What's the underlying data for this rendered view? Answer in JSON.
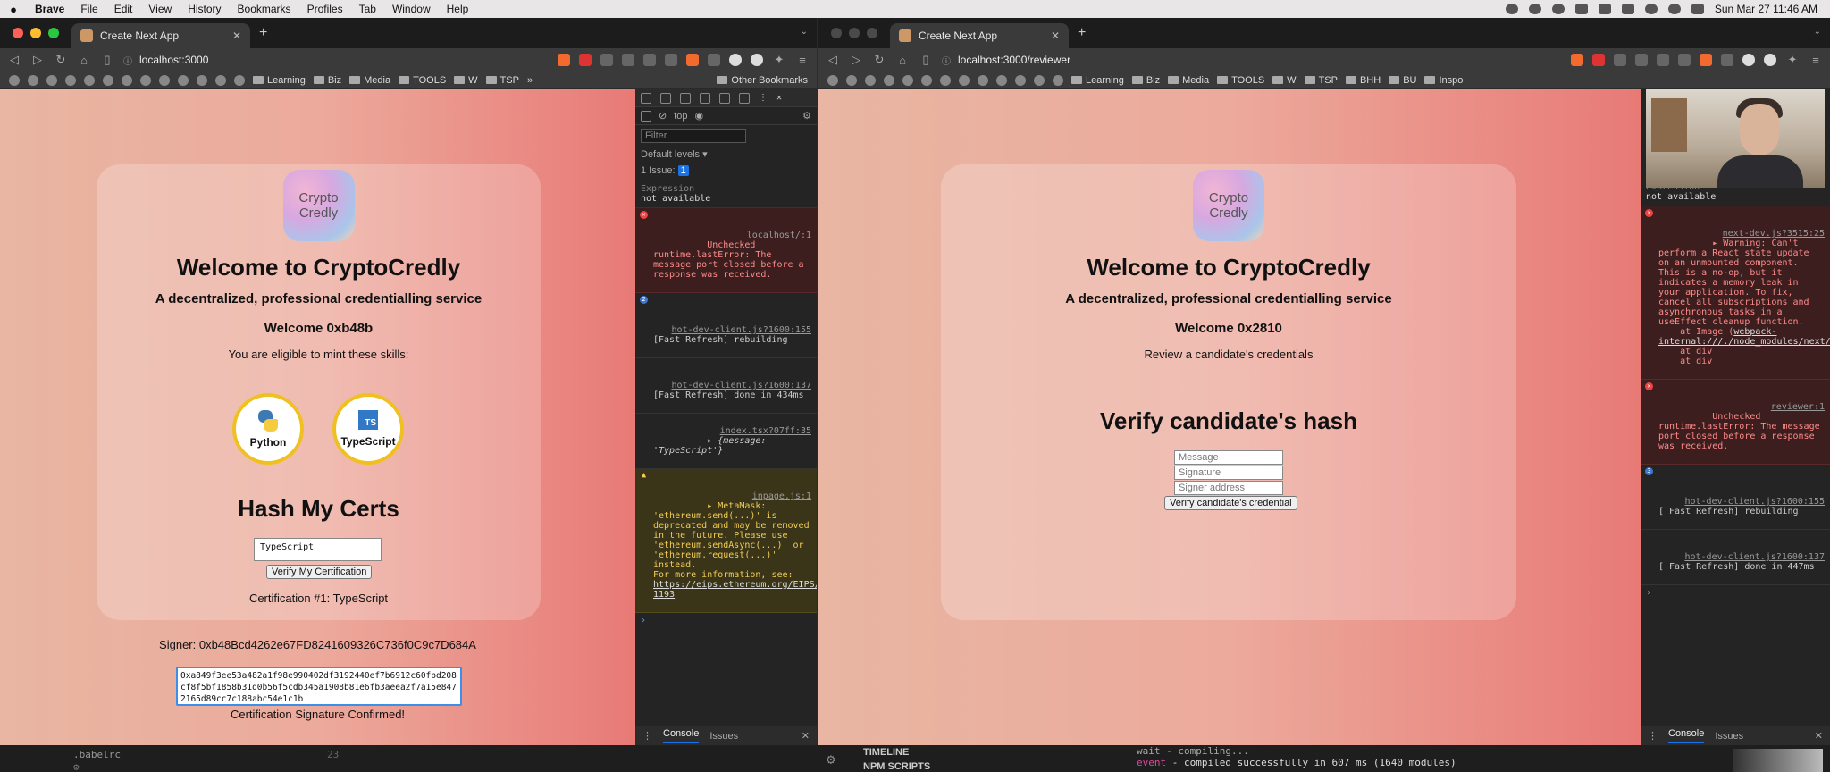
{
  "menubar": {
    "app": "Brave",
    "items": [
      "File",
      "Edit",
      "View",
      "History",
      "Bookmarks",
      "Profiles",
      "Tab",
      "Window",
      "Help"
    ],
    "clock": "Sun Mar 27  11:46 AM"
  },
  "left": {
    "tab_title": "Create Next App",
    "url": "localhost:3000",
    "bookmarks": [
      "Learning",
      "Biz",
      "Media",
      "TOOLS",
      "W",
      "TSP"
    ],
    "other_bookmarks": "Other Bookmarks",
    "page": {
      "logo_line1": "Crypto",
      "logo_line2": "Credly",
      "title": "Welcome to CryptoCredly",
      "subtitle": "A decentralized, professional credentialling service",
      "welcome": "Welcome 0xb48b",
      "eligible": "You are eligible to mint these skills:",
      "skills": [
        {
          "name": "Python",
          "icon": "python-icon"
        },
        {
          "name": "TypeScript",
          "icon": "typescript-icon",
          "badge": "TS"
        }
      ],
      "hash_heading": "Hash My Certs",
      "hash_input_value": "TypeScript",
      "verify_button": "Verify My Certification",
      "cert_line": "Certification #1: TypeScript",
      "signer_line": "Signer: 0xb48Bcd4262e67FD8241609326C736f0C9c7D684A",
      "signature": "0xa849f3ee53a482a1f98e990402df3192440ef7b6912c60fbd208cf8f5bf1858b31d0b56f5cdb345a1908b81e6fb3aeea2f7a15e8472165d89cc7c188abc54e1c1b",
      "confirmed": "Certification Signature Confirmed!"
    },
    "devtools": {
      "context": "top",
      "filter_placeholder": "Filter",
      "levels": "Default levels ▾",
      "issues_label": "1 Issue:",
      "issues_count": "1",
      "expression_label": "Expression",
      "expression_value": "not available",
      "logs": [
        {
          "kind": "err",
          "text": "Unchecked runtime.lastError: The message port closed before a response was received.",
          "src": "localhost/:1"
        },
        {
          "kind": "info",
          "count": "2",
          "text": "[Fast Refresh] rebuilding",
          "src": "hot-dev-client.js?1600:155"
        },
        {
          "kind": "info",
          "text": "[Fast Refresh] done in 434ms",
          "src": "hot-dev-client.js?1600:137"
        },
        {
          "kind": "obj",
          "text": "▸ {message: 'TypeScript'}",
          "src": "index.tsx?07ff:35"
        },
        {
          "kind": "warn",
          "text": "▸ MetaMask: 'ethereum.send(...)' is deprecated and may be removed in the future. Please use 'ethereum.sendAsync(...)' or 'ethereum.request(...)' instead.\nFor more information, see: ",
          "link": "https://eips.ethereum.org/EIPS/eip-1193",
          "src": "inpage.js:1"
        }
      ],
      "drawer_console": "Console",
      "drawer_issues": "Issues"
    }
  },
  "right": {
    "tab_title": "Create Next App",
    "url": "localhost:3000/reviewer",
    "bookmarks": [
      "Learning",
      "Biz",
      "Media",
      "TOOLS",
      "W",
      "TSP",
      "BHH",
      "BU",
      "Inspo"
    ],
    "page": {
      "logo_line1": "Crypto",
      "logo_line2": "Credly",
      "title": "Welcome to CryptoCredly",
      "subtitle": "A decentralized, professional credentialling service",
      "welcome": "Welcome 0x2810",
      "review": "Review a candidate's credentials",
      "verify_heading": "Verify candidate's hash",
      "message_placeholder": "Message",
      "signature_placeholder": "Signature",
      "signer_placeholder": "Signer address",
      "verify_button": "Verify candidate's credential"
    },
    "devtools": {
      "expression_label": "Expression",
      "expression_value": "not available",
      "logs": [
        {
          "kind": "err",
          "text": "▸ Warning: Can't perform a React state update on an unmounted component. This is a no-op, but it indicates a memory leak in your application. To fix, cancel all subscriptions and asynchronous tasks in a useEffect cleanup function.\n    at Image (",
          "link": "webpack-internal:///./node_modules/next/dist/client/image.js:87:22",
          "tail": ")\n    at div\n    at div",
          "src": "next-dev.js?3515:25"
        },
        {
          "kind": "err",
          "text": "Unchecked runtime.lastError: The message port closed before a response was received.",
          "src": "reviewer:1"
        },
        {
          "kind": "info",
          "count": "3",
          "text": "[ Fast Refresh] rebuilding",
          "src": "hot-dev-client.js?1600:155"
        },
        {
          "kind": "info",
          "text": "[ Fast Refresh] done in 447ms",
          "src": "hot-dev-client.js?1600:137"
        }
      ],
      "drawer_console": "Console",
      "drawer_issues": "Issues"
    }
  },
  "editor": {
    "file": ".babelrc",
    "line_no": "23",
    "timeline": "TIMELINE",
    "npm_scripts": "NPM SCRIPTS",
    "wait_line": "wait  - compiling...",
    "event_label": "event",
    "event_text": " - compiled successfully in 607 ms (1640 modules)"
  },
  "colors": {
    "page_gradient_start": "#e8b6a2",
    "page_gradient_end": "#e87a76",
    "skill_ring": "#f0c020",
    "devtools_error_bg": "#3c1e1e",
    "devtools_warn_bg": "#3a3418"
  }
}
